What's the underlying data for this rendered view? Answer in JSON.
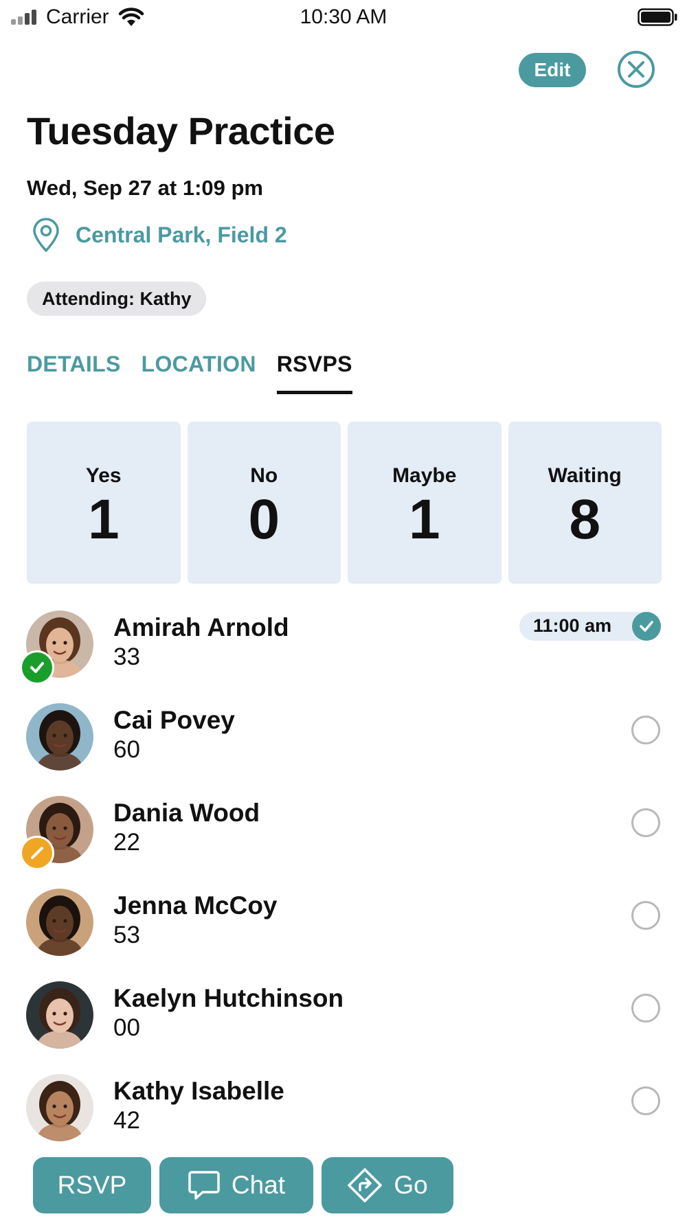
{
  "status_bar": {
    "carrier": "Carrier",
    "time": "10:30 AM"
  },
  "top_actions": {
    "edit_label": "Edit"
  },
  "event": {
    "title": "Tuesday Practice",
    "datetime": "Wed, Sep 27 at 1:09 pm",
    "location": "Central Park, Field 2",
    "attending_label": "Attending: Kathy"
  },
  "tabs": [
    {
      "label": "DETAILS",
      "active": false
    },
    {
      "label": "LOCATION",
      "active": false
    },
    {
      "label": "RSVPS",
      "active": true
    }
  ],
  "summary": [
    {
      "label": "Yes",
      "value": "1"
    },
    {
      "label": "No",
      "value": "0"
    },
    {
      "label": "Maybe",
      "value": "1"
    },
    {
      "label": "Waiting",
      "value": "8"
    }
  ],
  "people": [
    {
      "name": "Amirah Arnold",
      "number": "33",
      "status": "yes",
      "time": "11:00 am",
      "avatar_skin": "#e2b596",
      "avatar_hair": "#5a3520",
      "avatar_bg": "#c9b7a8"
    },
    {
      "name": "Cai Povey",
      "number": "60",
      "status": "none",
      "avatar_skin": "#5b3a28",
      "avatar_hair": "#1d1410",
      "avatar_bg": "#8fb6c9"
    },
    {
      "name": "Dania Wood",
      "number": "22",
      "status": "maybe",
      "avatar_skin": "#8a5a3e",
      "avatar_hair": "#2a1a12",
      "avatar_bg": "#c4a18a"
    },
    {
      "name": "Jenna McCoy",
      "number": "53",
      "status": "none",
      "avatar_skin": "#5e3b26",
      "avatar_hair": "#1b120d",
      "avatar_bg": "#c9a27c"
    },
    {
      "name": "Kaelyn Hutchinson",
      "number": "00",
      "status": "none",
      "avatar_skin": "#e8c2ac",
      "avatar_hair": "#3a2418",
      "avatar_bg": "#2d3438"
    },
    {
      "name": "Kathy Isabelle",
      "number": "42",
      "status": "none",
      "avatar_skin": "#b8835f",
      "avatar_hair": "#3b2316",
      "avatar_bg": "#e9e4df"
    }
  ],
  "actions": {
    "rsvp_label": "RSVP",
    "chat_label": "Chat",
    "go_label": "Go"
  },
  "colors": {
    "accent": "#4b9aa0",
    "yes": "#1a9e2b",
    "maybe": "#f0a623",
    "summary_bg": "#e4ecf6"
  }
}
